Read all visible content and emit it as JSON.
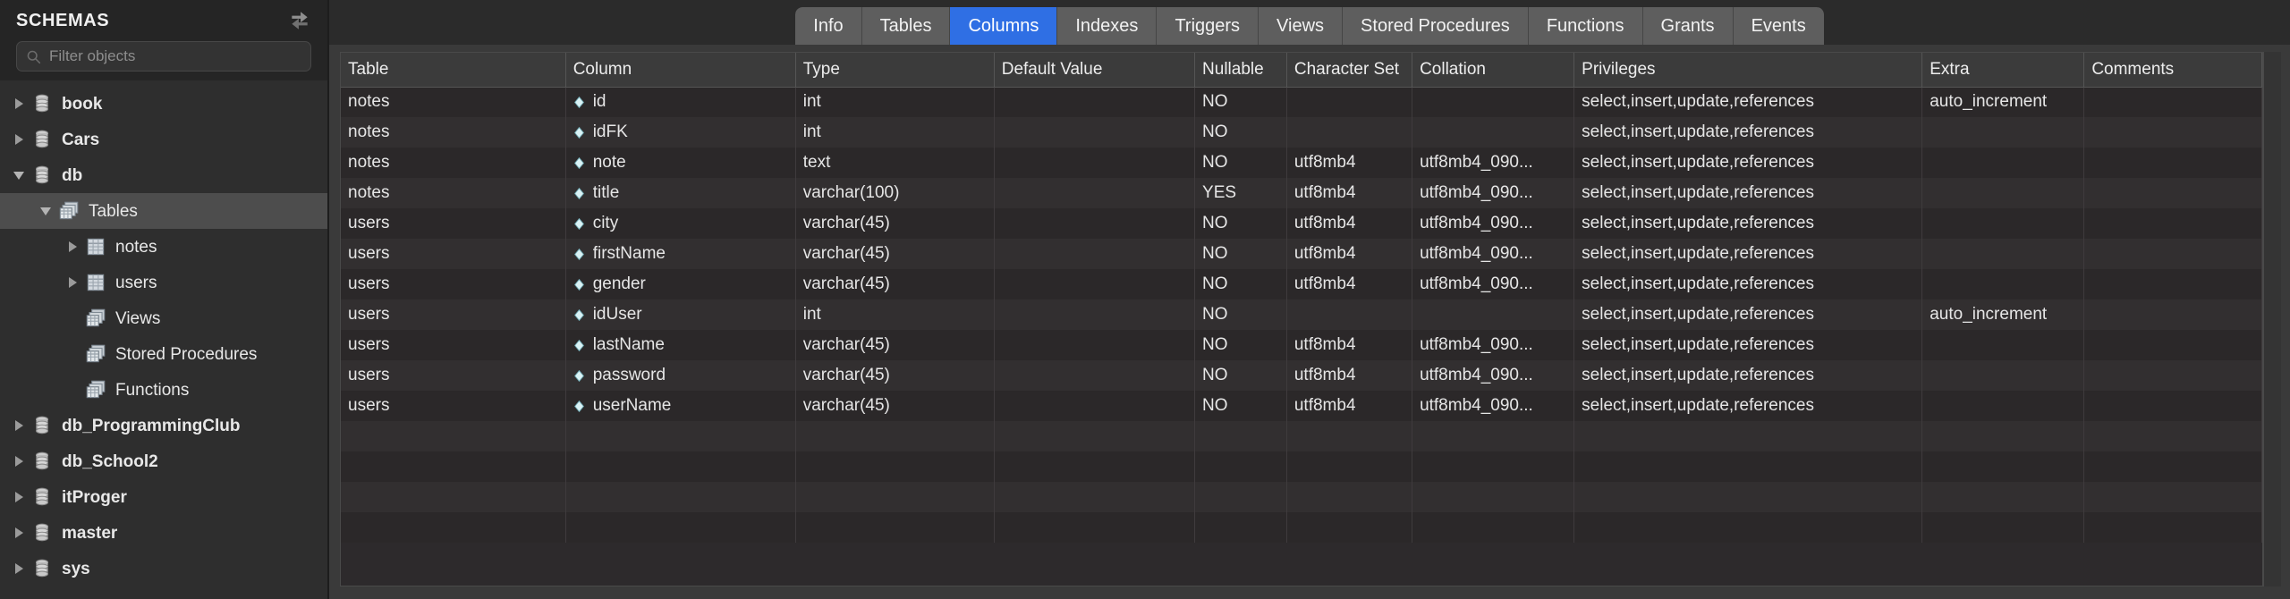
{
  "sidebar": {
    "title": "SCHEMAS",
    "refresh_icon": "refresh-icon",
    "filter": {
      "placeholder": "Filter objects",
      "value": "",
      "icon": "search-icon"
    },
    "tree": [
      {
        "label": "book",
        "icon": "database-icon",
        "indent": 0,
        "twisty": "right",
        "selected": false,
        "bold": true
      },
      {
        "label": "Cars",
        "icon": "database-icon",
        "indent": 0,
        "twisty": "right",
        "selected": false,
        "bold": true
      },
      {
        "label": "db",
        "icon": "database-icon",
        "indent": 0,
        "twisty": "down",
        "selected": false,
        "bold": true
      },
      {
        "label": "Tables",
        "icon": "tables-folder-icon",
        "indent": 1,
        "twisty": "down",
        "selected": true,
        "bold": false
      },
      {
        "label": "notes",
        "icon": "table-icon",
        "indent": 2,
        "twisty": "right",
        "selected": false,
        "bold": false
      },
      {
        "label": "users",
        "icon": "table-icon",
        "indent": 2,
        "twisty": "right",
        "selected": false,
        "bold": false
      },
      {
        "label": "Views",
        "icon": "views-folder-icon",
        "indent": 2,
        "twisty": "none",
        "selected": false,
        "bold": false
      },
      {
        "label": "Stored Procedures",
        "icon": "routines-folder-icon",
        "indent": 2,
        "twisty": "none",
        "selected": false,
        "bold": false
      },
      {
        "label": "Functions",
        "icon": "routines-folder-icon",
        "indent": 2,
        "twisty": "none",
        "selected": false,
        "bold": false
      },
      {
        "label": "db_ProgrammingClub",
        "icon": "database-icon",
        "indent": 0,
        "twisty": "right",
        "selected": false,
        "bold": true
      },
      {
        "label": "db_School2",
        "icon": "database-icon",
        "indent": 0,
        "twisty": "right",
        "selected": false,
        "bold": true
      },
      {
        "label": "itProger",
        "icon": "database-icon",
        "indent": 0,
        "twisty": "right",
        "selected": false,
        "bold": true
      },
      {
        "label": "master",
        "icon": "database-icon",
        "indent": 0,
        "twisty": "right",
        "selected": false,
        "bold": true
      },
      {
        "label": "sys",
        "icon": "database-icon",
        "indent": 0,
        "twisty": "right",
        "selected": false,
        "bold": true
      }
    ]
  },
  "main": {
    "tabs": [
      {
        "label": "Info",
        "active": false
      },
      {
        "label": "Tables",
        "active": false
      },
      {
        "label": "Columns",
        "active": true
      },
      {
        "label": "Indexes",
        "active": false
      },
      {
        "label": "Triggers",
        "active": false
      },
      {
        "label": "Views",
        "active": false
      },
      {
        "label": "Stored Procedures",
        "active": false
      },
      {
        "label": "Functions",
        "active": false
      },
      {
        "label": "Grants",
        "active": false
      },
      {
        "label": "Events",
        "active": false
      }
    ],
    "grid": {
      "columns": [
        "Table",
        "Column",
        "Type",
        "Default Value",
        "Nullable",
        "Character Set",
        "Collation",
        "Privileges",
        "Extra",
        "Comments"
      ],
      "rows": [
        {
          "table": "notes",
          "column": "id",
          "type": "int",
          "default": "",
          "nullable": "NO",
          "charset": "",
          "collation": "",
          "privileges": "select,insert,update,references",
          "extra": "auto_increment",
          "comments": ""
        },
        {
          "table": "notes",
          "column": "idFK",
          "type": "int",
          "default": "",
          "nullable": "NO",
          "charset": "",
          "collation": "",
          "privileges": "select,insert,update,references",
          "extra": "",
          "comments": ""
        },
        {
          "table": "notes",
          "column": "note",
          "type": "text",
          "default": "",
          "nullable": "NO",
          "charset": "utf8mb4",
          "collation": "utf8mb4_090...",
          "privileges": "select,insert,update,references",
          "extra": "",
          "comments": ""
        },
        {
          "table": "notes",
          "column": "title",
          "type": "varchar(100)",
          "default": "",
          "nullable": "YES",
          "charset": "utf8mb4",
          "collation": "utf8mb4_090...",
          "privileges": "select,insert,update,references",
          "extra": "",
          "comments": ""
        },
        {
          "table": "users",
          "column": "city",
          "type": "varchar(45)",
          "default": "",
          "nullable": "NO",
          "charset": "utf8mb4",
          "collation": "utf8mb4_090...",
          "privileges": "select,insert,update,references",
          "extra": "",
          "comments": ""
        },
        {
          "table": "users",
          "column": "firstName",
          "type": "varchar(45)",
          "default": "",
          "nullable": "NO",
          "charset": "utf8mb4",
          "collation": "utf8mb4_090...",
          "privileges": "select,insert,update,references",
          "extra": "",
          "comments": ""
        },
        {
          "table": "users",
          "column": "gender",
          "type": "varchar(45)",
          "default": "",
          "nullable": "NO",
          "charset": "utf8mb4",
          "collation": "utf8mb4_090...",
          "privileges": "select,insert,update,references",
          "extra": "",
          "comments": ""
        },
        {
          "table": "users",
          "column": "idUser",
          "type": "int",
          "default": "",
          "nullable": "NO",
          "charset": "",
          "collation": "",
          "privileges": "select,insert,update,references",
          "extra": "auto_increment",
          "comments": ""
        },
        {
          "table": "users",
          "column": "lastName",
          "type": "varchar(45)",
          "default": "",
          "nullable": "NO",
          "charset": "utf8mb4",
          "collation": "utf8mb4_090...",
          "privileges": "select,insert,update,references",
          "extra": "",
          "comments": ""
        },
        {
          "table": "users",
          "column": "password",
          "type": "varchar(45)",
          "default": "",
          "nullable": "NO",
          "charset": "utf8mb4",
          "collation": "utf8mb4_090...",
          "privileges": "select,insert,update,references",
          "extra": "",
          "comments": ""
        },
        {
          "table": "users",
          "column": "userName",
          "type": "varchar(45)",
          "default": "",
          "nullable": "NO",
          "charset": "utf8mb4",
          "collation": "utf8mb4_090...",
          "privileges": "select,insert,update,references",
          "extra": "",
          "comments": ""
        }
      ],
      "empty_row_count": 4,
      "column_marker_icon": "diamond-icon"
    }
  },
  "colors": {
    "accent": "#2f6fe4",
    "sidebar_bg": "#2e2e2e",
    "sidebar_header_bg": "#252525",
    "selection_bg": "#4d4d4d",
    "grid_row_even": "#2b2829",
    "grid_row_odd": "#322f30",
    "grid_header_bg": "#3b3b3b",
    "tab_bg": "#5e5e5e",
    "text": "#e8e8e8"
  }
}
